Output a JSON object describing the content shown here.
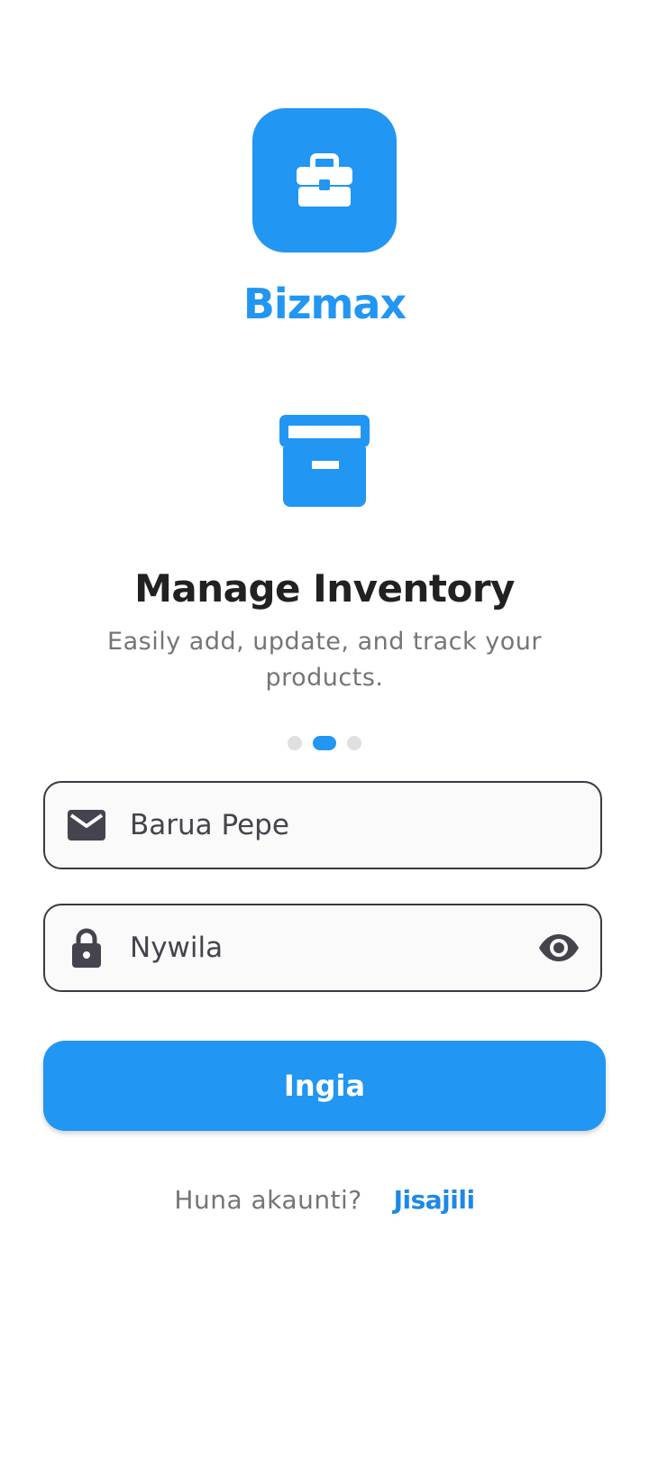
{
  "app": {
    "name": "Bizmax",
    "logo_icon": "briefcase-icon",
    "accent_color": "#2196F3"
  },
  "onboarding": {
    "icon": "archive-box-icon",
    "title": "Manage Inventory",
    "description": "Easily add, update, and track your products.",
    "page_count": 3,
    "active_page": 2
  },
  "login_form": {
    "email": {
      "icon": "mail-icon",
      "placeholder": "Barua Pepe",
      "value": ""
    },
    "password": {
      "icon": "lock-icon",
      "placeholder": "Nywila",
      "value": "",
      "toggle_icon": "eye-icon"
    },
    "submit_label": "Ingia"
  },
  "signup": {
    "prompt": "Huna akaunti?",
    "link_label": "Jisajili"
  }
}
